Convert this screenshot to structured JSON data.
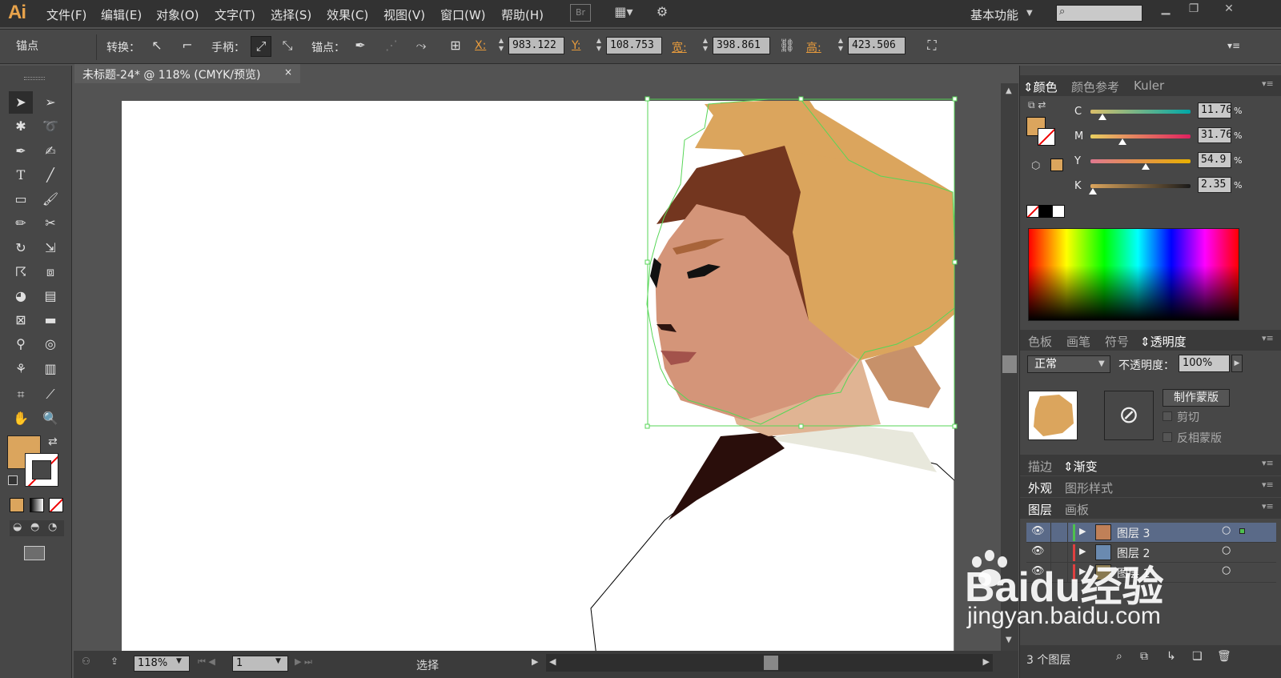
{
  "app": {
    "logo": "Ai",
    "workspace": "基本功能"
  },
  "menus": [
    "文件(F)",
    "编辑(E)",
    "对象(O)",
    "文字(T)",
    "选择(S)",
    "效果(C)",
    "视图(V)",
    "窗口(W)",
    "帮助(H)"
  ],
  "menubar_icons": {
    "bridge": "Br"
  },
  "control": {
    "mode_label": "锚点",
    "convert_label": "转换：",
    "handles_label": "手柄：",
    "anchors_label": "锚点：",
    "x_label": "X:",
    "x_value": "983.122 p",
    "y_label": "Y:",
    "y_value": "108.753 p",
    "w_label": "宽:",
    "w_value": "398.861 p",
    "h_label": "高:",
    "h_value": "423.506 p"
  },
  "document": {
    "tab_title": "未标题-24* @ 118% (CMYK/预览)",
    "close": "×"
  },
  "status": {
    "zoom": "118%",
    "page": "1",
    "tool": "选择"
  },
  "color_panel": {
    "tabs": [
      "颜色",
      "颜色参考",
      "Kuler"
    ],
    "channels": [
      {
        "label": "C",
        "value": "11.76",
        "unit": "%",
        "level": 0.1176
      },
      {
        "label": "M",
        "value": "31.76",
        "unit": "%",
        "level": 0.3176
      },
      {
        "label": "Y",
        "value": "54.9",
        "unit": "%",
        "level": 0.549
      },
      {
        "label": "K",
        "value": "2.35",
        "unit": "%",
        "level": 0.0235
      }
    ],
    "fill_color": "#dba55d"
  },
  "transparency_panel": {
    "tabs": [
      "色板",
      "画笔",
      "符号",
      "透明度"
    ],
    "blend_mode": "正常",
    "opacity_label": "不透明度：",
    "opacity_value": "100%",
    "make_mask": "制作蒙版",
    "clip": "剪切",
    "invert_mask": "反相蒙版"
  },
  "stroke_panel": {
    "tabs": [
      "描边",
      "渐变"
    ]
  },
  "appearance_panel": {
    "tabs": [
      "外观",
      "图形样式"
    ]
  },
  "layers_panel": {
    "tabs": [
      "图层",
      "画板"
    ],
    "layers": [
      {
        "name": "图层 3"
      },
      {
        "name": "图层 2"
      },
      {
        "name": "图层 1"
      }
    ],
    "count": "3 个图层"
  },
  "watermark": {
    "brand": "Baidu经验",
    "url": "jingyan.baidu.com"
  }
}
